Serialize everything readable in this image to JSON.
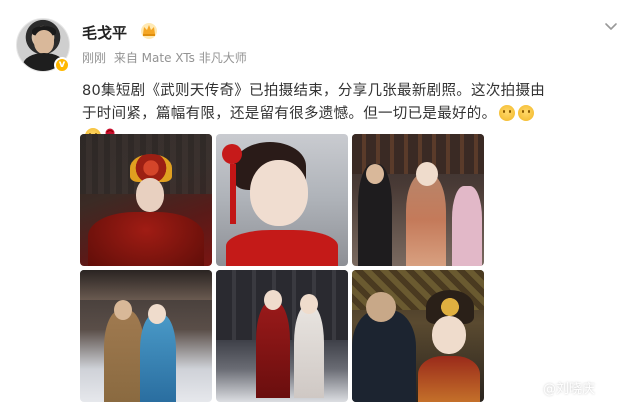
{
  "post": {
    "author": {
      "name": "毛戈平",
      "verified_badge": "v",
      "crown_icon": "crown-icon"
    },
    "meta": {
      "time": "刚刚",
      "source": "来自 Mate XTs 非凡大师"
    },
    "text": "80集短剧《武则天传奇》已拍摄结束，分享几张最新剧照。这次拍摄由于时间紧，篇幅有限，还是留有很多遗憾。但一切已是最好的。",
    "emojis": [
      "smile-emoji",
      "smile-emoji",
      "smile-emoji",
      "rose-emoji"
    ],
    "photos": [
      {
        "id": "photo-1",
        "desc": "portrait-red-fur-headdress"
      },
      {
        "id": "photo-2",
        "desc": "closeup-red-ornaments"
      },
      {
        "id": "photo-3",
        "desc": "palace-scene-group"
      },
      {
        "id": "photo-4",
        "desc": "snow-pavilion-couple"
      },
      {
        "id": "photo-5",
        "desc": "two-women-snow"
      },
      {
        "id": "photo-6",
        "desc": "makeup-artist-working"
      }
    ]
  },
  "watermark": {
    "text": "@刘晓庆"
  },
  "colors": {
    "accent_orange": "#ffb800",
    "text_main": "#333333",
    "text_meta": "#939393"
  }
}
